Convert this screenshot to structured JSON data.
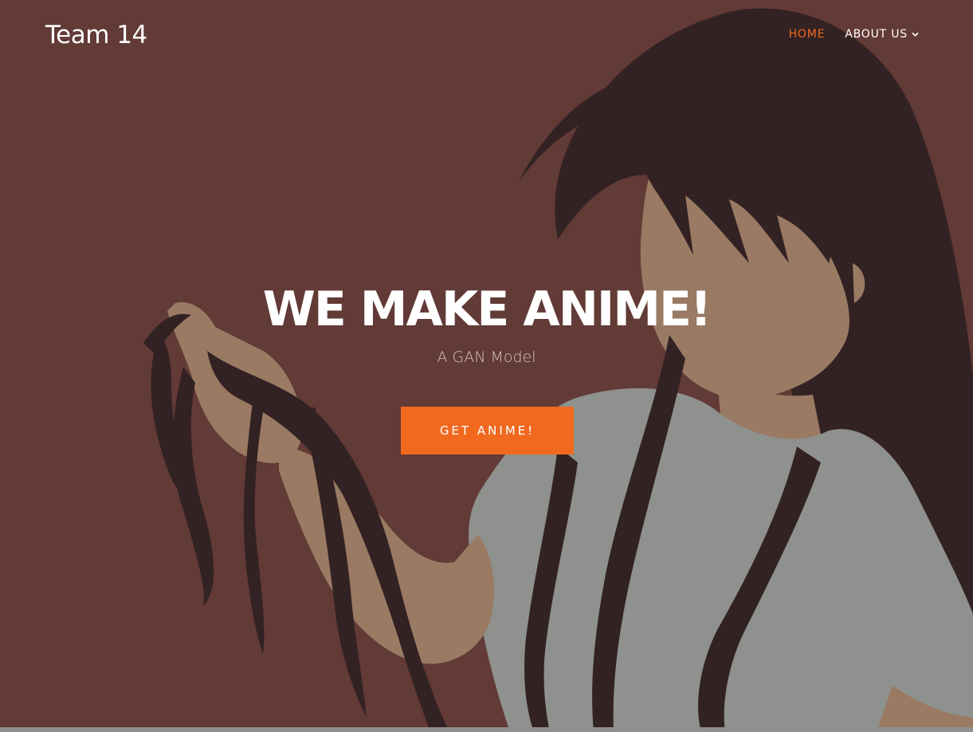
{
  "header": {
    "logo": "Team 14",
    "nav": [
      {
        "label": "HOME",
        "active": true
      },
      {
        "label": "ABOUT US",
        "active": false,
        "has_dropdown": true
      }
    ]
  },
  "hero": {
    "title": "WE MAKE ANIME!",
    "subtitle": "A GAN Model",
    "cta_label": "GET ANIME!",
    "background_image": "anime girl silhouette holding hair"
  },
  "colors": {
    "background": "#623a36",
    "accent": "#f0691f",
    "hair": "#332223",
    "skin": "#9a7a63",
    "shirt": "#8e918e",
    "bottom_bar": "#8f8f8f"
  },
  "icons": {
    "dropdown": "chevron-down-icon"
  }
}
